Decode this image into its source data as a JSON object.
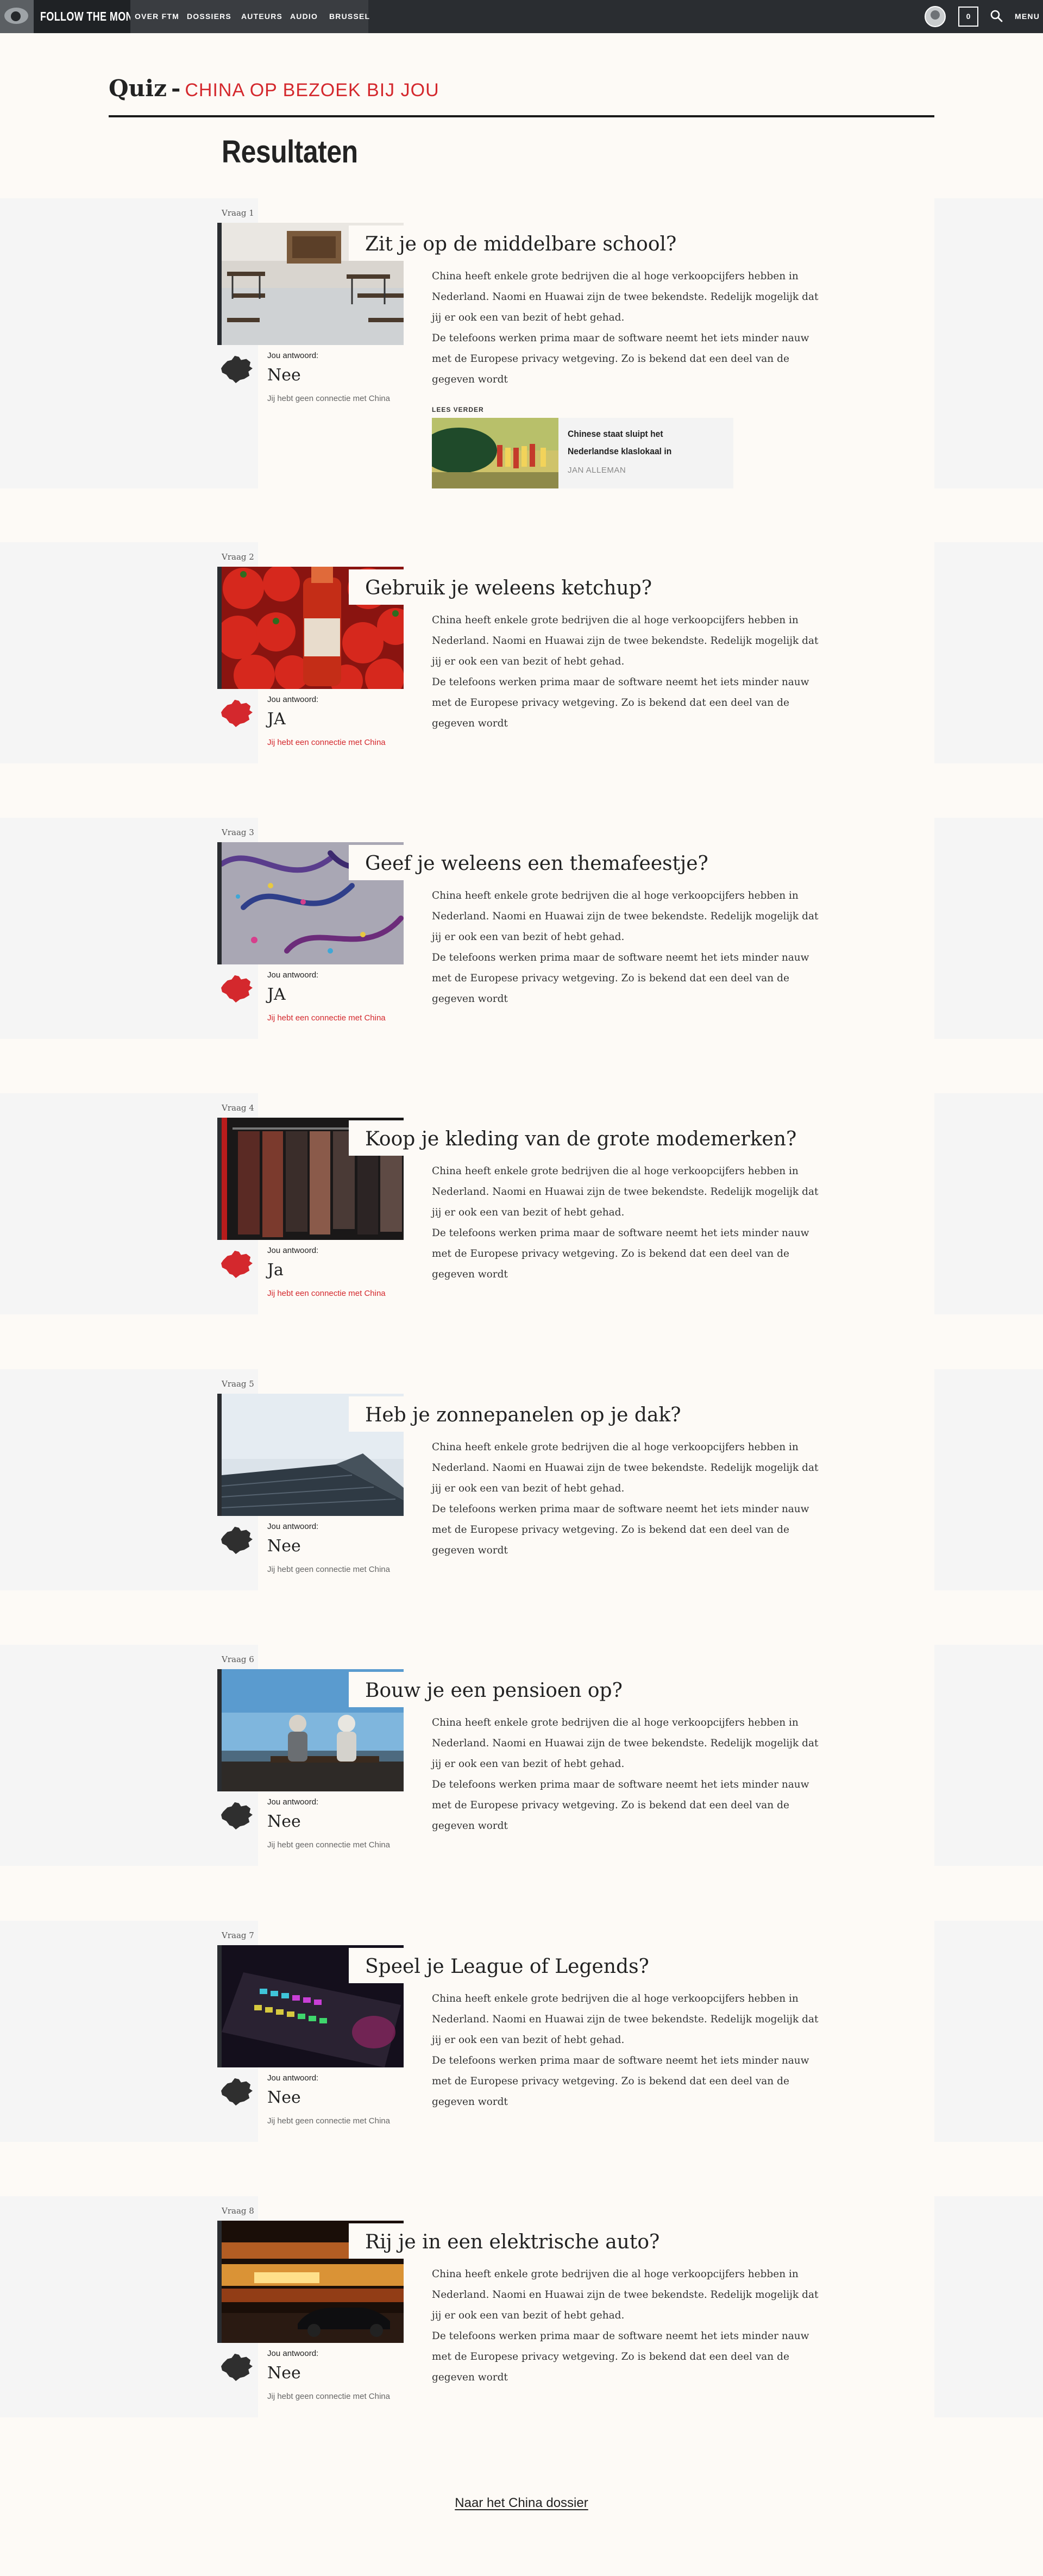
{
  "header": {
    "logo_text": "FOLLOW THE MONEY",
    "nav": [
      "OVER FTM",
      "DOSSIERS",
      "AUTEURS",
      "AUDIO",
      "BRUSSEL"
    ],
    "cart_count": "0",
    "menu_label": "MENU"
  },
  "quiz": {
    "title_prefix": "Quiz",
    "title_dash": "-",
    "subtitle": "CHINA OP BEZOEK BIJ JOU"
  },
  "results_heading": "Resultaten",
  "answer_label": "Jou antwoord:",
  "body_text": "China heeft enkele grote bedrijven die al hoge verkoopcijfers hebben in Nederland. Naomi en Huawai zijn de twee bekendste. Redelijk mogelijk dat jij er ook een van bezit of hebt gehad.",
  "body_text_2": "De telefoons werken prima maar de software neemt het iets minder nauw met de Europese privacy wetgeving. Zo is bekend dat een deel van de gegeven wordt",
  "questions": [
    {
      "vraag": "Vraag 1",
      "title": "Zit je op de middelbare school?",
      "answer": "Nee",
      "connected": false,
      "connection": "Jij hebt geen connectie met China"
    },
    {
      "vraag": "Vraag 2",
      "title": "Gebruik je weleens ketchup?",
      "answer": "JA",
      "connected": true,
      "connection": "Jij hebt een connectie met China"
    },
    {
      "vraag": "Vraag 3",
      "title": "Geef je weleens een themafeestje?",
      "answer": "JA",
      "connected": true,
      "connection": "Jij hebt een connectie met China"
    },
    {
      "vraag": "Vraag 4",
      "title": "Koop je kleding van de grote modemerken?",
      "answer": "Ja",
      "connected": true,
      "connection": "Jij hebt een connectie met China"
    },
    {
      "vraag": "Vraag 5",
      "title": "Heb je zonnepanelen op je dak?",
      "answer": "Nee",
      "connected": false,
      "connection": "Jij hebt geen connectie met China"
    },
    {
      "vraag": "Vraag 6",
      "title": "Bouw je een pensioen op?",
      "answer": "Nee",
      "connected": false,
      "connection": "Jij hebt geen connectie met China"
    },
    {
      "vraag": "Vraag 7",
      "title": "Speel je League of Legends?",
      "answer": "Nee",
      "connected": false,
      "connection": "Jij hebt geen connectie met China"
    },
    {
      "vraag": "Vraag 8",
      "title": "Rij je in een elektrische auto?",
      "answer": "Nee",
      "connected": false,
      "connection": "Jij hebt geen connectie met China"
    }
  ],
  "lees_verder": {
    "label": "LEES VERDER",
    "title": "Chinese staat sluipt het Nederlandse klaslokaal in",
    "author": "JAN ALLEMAN"
  },
  "footer_link": "Naar het China dossier",
  "colors": {
    "accent_red": "#d4282d",
    "topbar": "#2a2d31",
    "page_bg": "#fdfaf6",
    "band_bg": "#f5f5f5"
  }
}
